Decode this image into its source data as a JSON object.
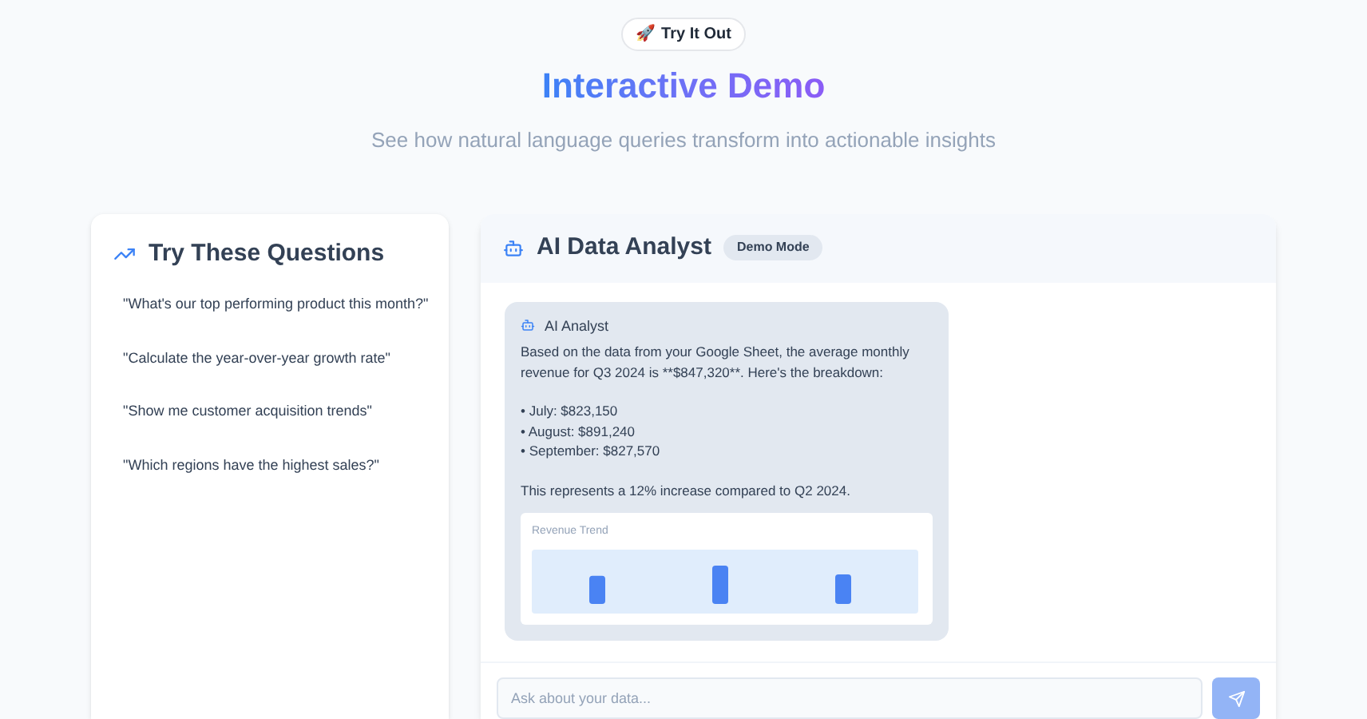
{
  "badge": {
    "icon": "🚀",
    "label": "Try It Out"
  },
  "title": "Interactive Demo",
  "subtitle": "See how natural language queries transform into actionable insights",
  "questions_panel": {
    "title": "Try These Questions",
    "questions": [
      "\"What's our top performing product this month?\"",
      "\"Calculate the year-over-year growth rate\"",
      "\"Show me customer acquisition trends\"",
      "\"Which regions have the highest sales?\""
    ]
  },
  "chat": {
    "title": "AI Data Analyst",
    "mode_badge": "Demo Mode",
    "message": {
      "sender": "AI Analyst",
      "intro": "Based on the data from your Google Sheet, the average monthly revenue for Q3 2024 is **$847,320**. Here's the breakdown:",
      "bullets": [
        "• July: $823,150",
        "• August: $891,240",
        "• September: $827,570"
      ],
      "conclusion": "This represents a 12% increase compared to Q2 2024.",
      "chart_title": "Revenue Trend"
    },
    "input": {
      "placeholder": "Ask about your data..."
    }
  }
}
